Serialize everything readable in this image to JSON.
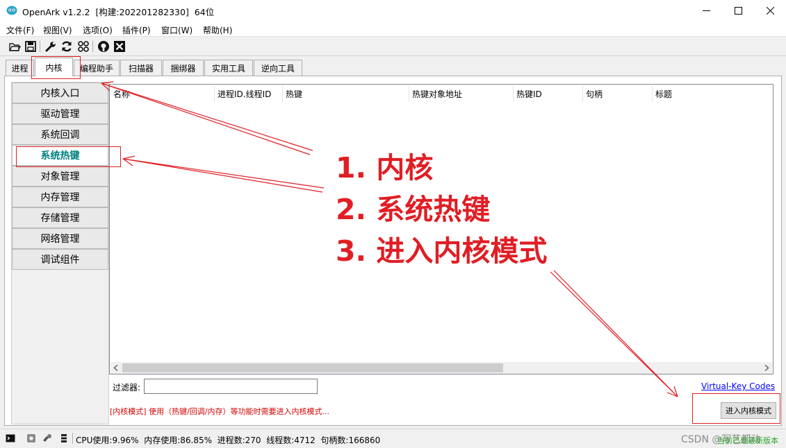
{
  "window": {
    "title": "OpenArk v1.2.2  [构建:202201282330]  64位"
  },
  "menu": [
    "文件(F)",
    "视图(V)",
    "选项(O)",
    "插件(P)",
    "窗口(W)",
    "帮助(H)"
  ],
  "toolbar": [
    "folder-open-icon",
    "save-icon",
    "wrench-icon",
    "refresh-icon",
    "grid-icon",
    "github-icon",
    "close-box-icon"
  ],
  "tabs": [
    {
      "label": "进程",
      "active": false
    },
    {
      "label": "内核",
      "active": true
    },
    {
      "label": "编程助手",
      "active": false
    },
    {
      "label": "扫描器",
      "active": false
    },
    {
      "label": "捆绑器",
      "active": false
    },
    {
      "label": "实用工具",
      "active": false
    },
    {
      "label": "逆向工具",
      "active": false
    }
  ],
  "nav": [
    {
      "label": "内核入口",
      "selected": false
    },
    {
      "label": "驱动管理",
      "selected": false
    },
    {
      "label": "系统回调",
      "selected": false
    },
    {
      "label": "系统热键",
      "selected": true
    },
    {
      "label": "对象管理",
      "selected": false
    },
    {
      "label": "内存管理",
      "selected": false
    },
    {
      "label": "存储管理",
      "selected": false
    },
    {
      "label": "网络管理",
      "selected": false
    },
    {
      "label": "调试组件",
      "selected": false
    }
  ],
  "columns": [
    "名称",
    "进程ID.线程ID",
    "热键",
    "热键对象地址",
    "热键ID",
    "句柄",
    "标题"
  ],
  "filter": {
    "label": "过滤器:",
    "value": ""
  },
  "vk_link": "Virtual-Key Codes",
  "hint": "[内核模式] 使用（热键/回调/内存）等功能时需要进入内核模式...",
  "enter_button": "进入内核模式",
  "status": {
    "text": "CPU使用:9.96%  内存使用:86.85%  进程数:270  线程数:4712  句柄数:166860",
    "watermark": "CSDN @写艺都动",
    "update": "当前已是最新版本"
  },
  "annotation": {
    "lines": [
      "1. 内核",
      "2. 系统热键",
      "3. 进入内核模式"
    ],
    "color": "#e01e24"
  }
}
